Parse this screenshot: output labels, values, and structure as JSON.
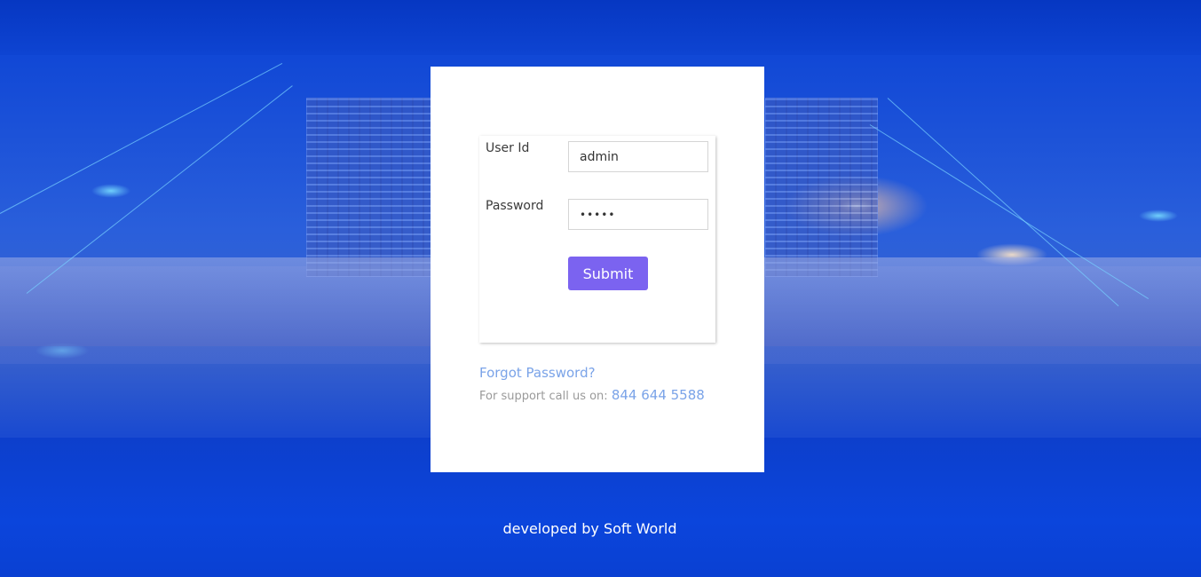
{
  "login": {
    "user_id_label": "User Id",
    "user_id_value": "admin",
    "password_label": "Password",
    "password_value": "•••••",
    "submit_label": "Submit",
    "forgot_password": "Forgot Password?",
    "support_text": "For support call us on:",
    "support_phone": "844 644 5588"
  },
  "footer": {
    "text": "developed by Soft World"
  },
  "colors": {
    "accent": "#7b63f0",
    "link": "#7aa3e8",
    "background": "#0a3dc9"
  }
}
